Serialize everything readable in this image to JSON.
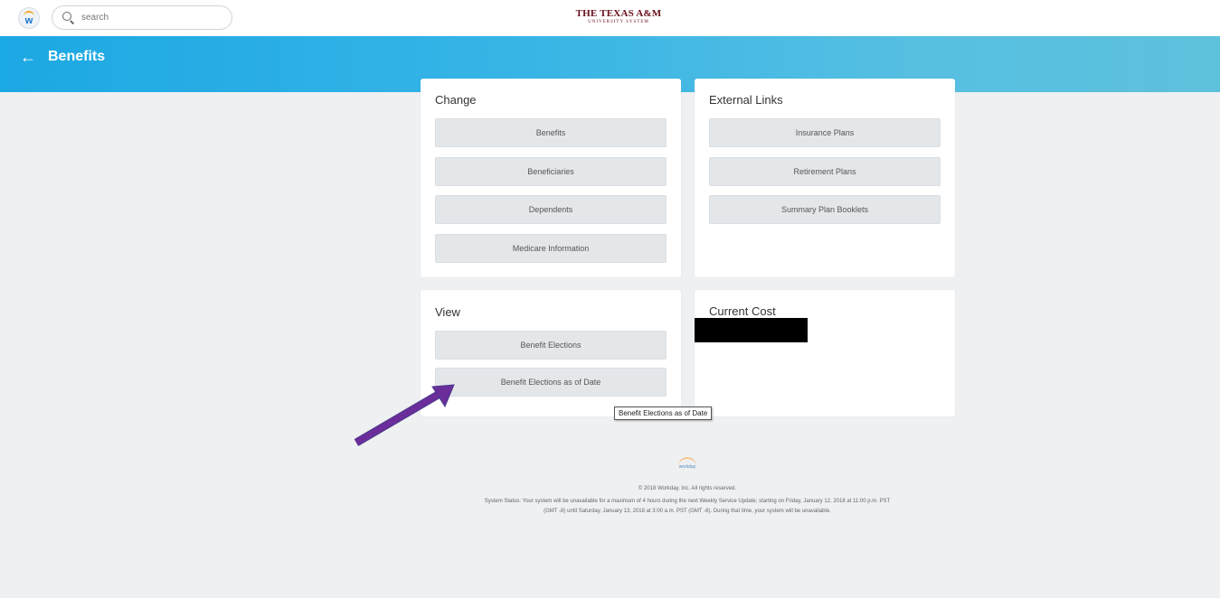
{
  "app": {
    "search_placeholder": "search",
    "brand_line1": "THE TEXAS A&M",
    "brand_line2": "UNIVERSITY SYSTEM"
  },
  "header": {
    "back_icon": "←",
    "title": "Benefits"
  },
  "change": {
    "title": "Change",
    "items": [
      "Benefits",
      "Beneficiaries",
      "Dependents",
      "Medicare Information"
    ]
  },
  "external_links": {
    "title": "External Links",
    "items": [
      "Insurance Plans",
      "Retirement Plans",
      "Summary Plan Booklets"
    ]
  },
  "view": {
    "title": "View",
    "items": [
      "Benefit Elections",
      "Benefit Elections as of Date"
    ]
  },
  "current_cost": {
    "title": "Current Cost"
  },
  "tooltip": {
    "text": "Benefit Elections as of Date"
  },
  "footer": {
    "logo_word": "workday",
    "copyright": "© 2018 Workday, Inc. All rights reserved.",
    "status": "System Status: Your system will be unavailable for a maximum of 4 hours during the next Weekly Service Update; starting on Friday, January 12, 2018 at 11:00 p.m. PST (GMT -8) until Saturday, January 13, 2018 at 3:00 a.m. PST (GMT -8). During that time, your system will be unavailable."
  },
  "colors": {
    "header_start": "#1ca8e3",
    "header_end": "#5ec1dc",
    "arrow": "#6a2d9a",
    "brand": "#6b0f1a"
  }
}
